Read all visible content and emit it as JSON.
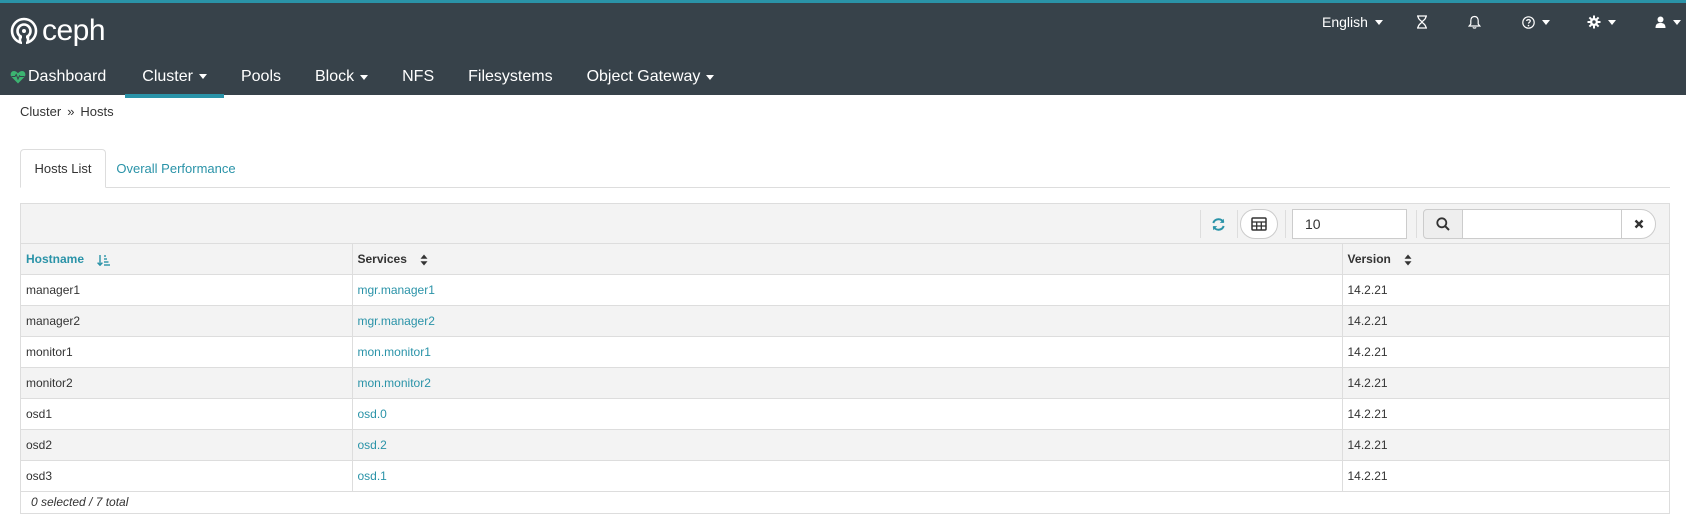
{
  "app": {
    "logo_text": "ceph"
  },
  "topbar": {
    "language": "English",
    "icons": [
      "hourglass-icon",
      "bell-icon",
      "help-icon",
      "gear-icon",
      "user-icon"
    ]
  },
  "nav": {
    "items": [
      {
        "label": "Dashboard",
        "icon": "heartbeat-icon",
        "has_caret": false
      },
      {
        "label": "Cluster",
        "active": true,
        "has_caret": true
      },
      {
        "label": "Pools",
        "has_caret": false
      },
      {
        "label": "Block",
        "has_caret": true
      },
      {
        "label": "NFS",
        "has_caret": false
      },
      {
        "label": "Filesystems",
        "has_caret": false
      },
      {
        "label": "Object Gateway",
        "has_caret": true
      }
    ]
  },
  "breadcrumb": {
    "parent": "Cluster",
    "current": "Hosts"
  },
  "tabs": [
    {
      "label": "Hosts List",
      "active": true
    },
    {
      "label": "Overall Performance",
      "active": false
    }
  ],
  "toolbar": {
    "page_size": "10",
    "search_value": ""
  },
  "table": {
    "columns": [
      "Hostname",
      "Services",
      "Version"
    ],
    "sorted_column": "Hostname",
    "rows": [
      {
        "hostname": "manager1",
        "services": "mgr.manager1",
        "version": "14.2.21"
      },
      {
        "hostname": "manager2",
        "services": "mgr.manager2",
        "version": "14.2.21"
      },
      {
        "hostname": "monitor1",
        "services": "mon.monitor1",
        "version": "14.2.21"
      },
      {
        "hostname": "monitor2",
        "services": "mon.monitor2",
        "version": "14.2.21"
      },
      {
        "hostname": "osd1",
        "services": "osd.0",
        "version": "14.2.21"
      },
      {
        "hostname": "osd2",
        "services": "osd.2",
        "version": "14.2.21"
      },
      {
        "hostname": "osd3",
        "services": "osd.1",
        "version": "14.2.21"
      }
    ],
    "footer": "0 selected / 7 total"
  },
  "colors": {
    "topbar_bg": "#37424a",
    "accent": "#2a93a8",
    "heartbeat": "#3cb371"
  }
}
